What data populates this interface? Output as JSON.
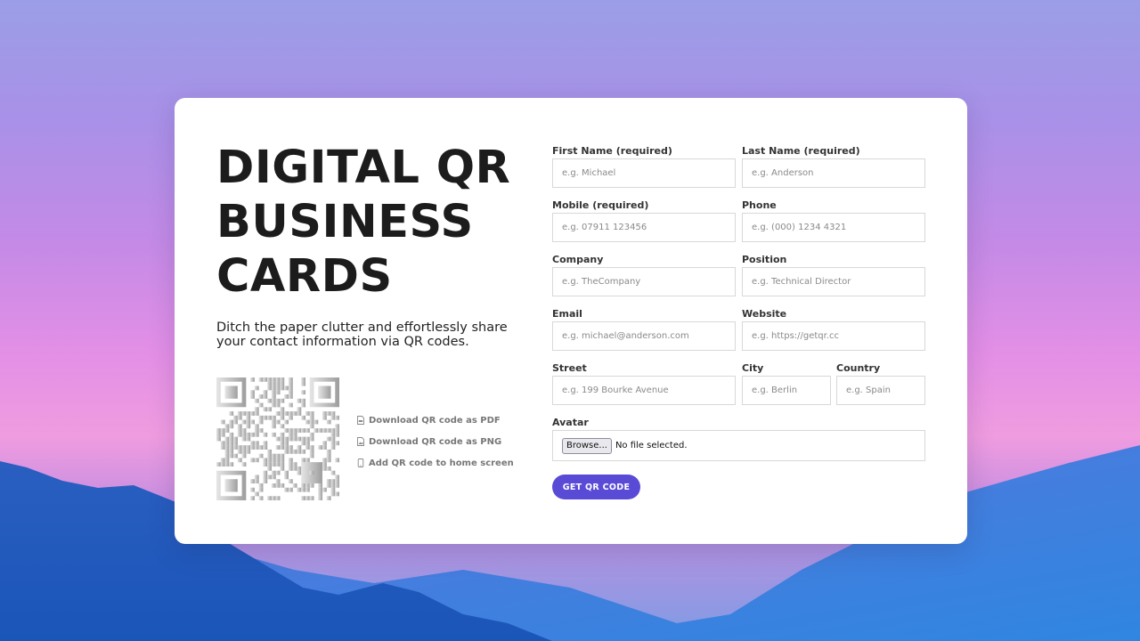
{
  "hero": {
    "title_lines": [
      "DIGITAL QR",
      "BUSINESS",
      "CARDS"
    ],
    "subtitle": "Ditch the paper clutter and effortlessly share your contact information via QR codes."
  },
  "qr_actions": [
    {
      "label": "Download QR code as PDF",
      "icon": "pdf-file-icon"
    },
    {
      "label": "Download QR code as PNG",
      "icon": "image-file-icon"
    },
    {
      "label": "Add QR code to home screen",
      "icon": "phone-icon"
    }
  ],
  "form": {
    "first_name": {
      "label": "First Name (required)",
      "placeholder": "e.g. Michael",
      "value": ""
    },
    "last_name": {
      "label": "Last Name (required)",
      "placeholder": "e.g. Anderson",
      "value": ""
    },
    "mobile": {
      "label": "Mobile (required)",
      "placeholder": "e.g. 07911 123456",
      "value": ""
    },
    "phone": {
      "label": "Phone",
      "placeholder": "e.g. (000) 1234 4321",
      "value": ""
    },
    "company": {
      "label": "Company",
      "placeholder": "e.g. TheCompany",
      "value": ""
    },
    "position": {
      "label": "Position",
      "placeholder": "e.g. Technical Director",
      "value": ""
    },
    "email": {
      "label": "Email",
      "placeholder": "e.g. michael@anderson.com",
      "value": ""
    },
    "website": {
      "label": "Website",
      "placeholder": "e.g. https://getqr.cc",
      "value": ""
    },
    "street": {
      "label": "Street",
      "placeholder": "e.g. 199 Bourke Avenue",
      "value": ""
    },
    "city": {
      "label": "City",
      "placeholder": "e.g. Berlin",
      "value": ""
    },
    "country": {
      "label": "Country",
      "placeholder": "e.g. Spain",
      "value": ""
    },
    "avatar": {
      "label": "Avatar",
      "browse_label": "Browse...",
      "file_status": "No file selected."
    },
    "submit_label": "GET QR CODE"
  },
  "colors": {
    "accent": "#5a4bd6",
    "title": "#1c1c1c",
    "input_border": "#d8d8d8"
  }
}
